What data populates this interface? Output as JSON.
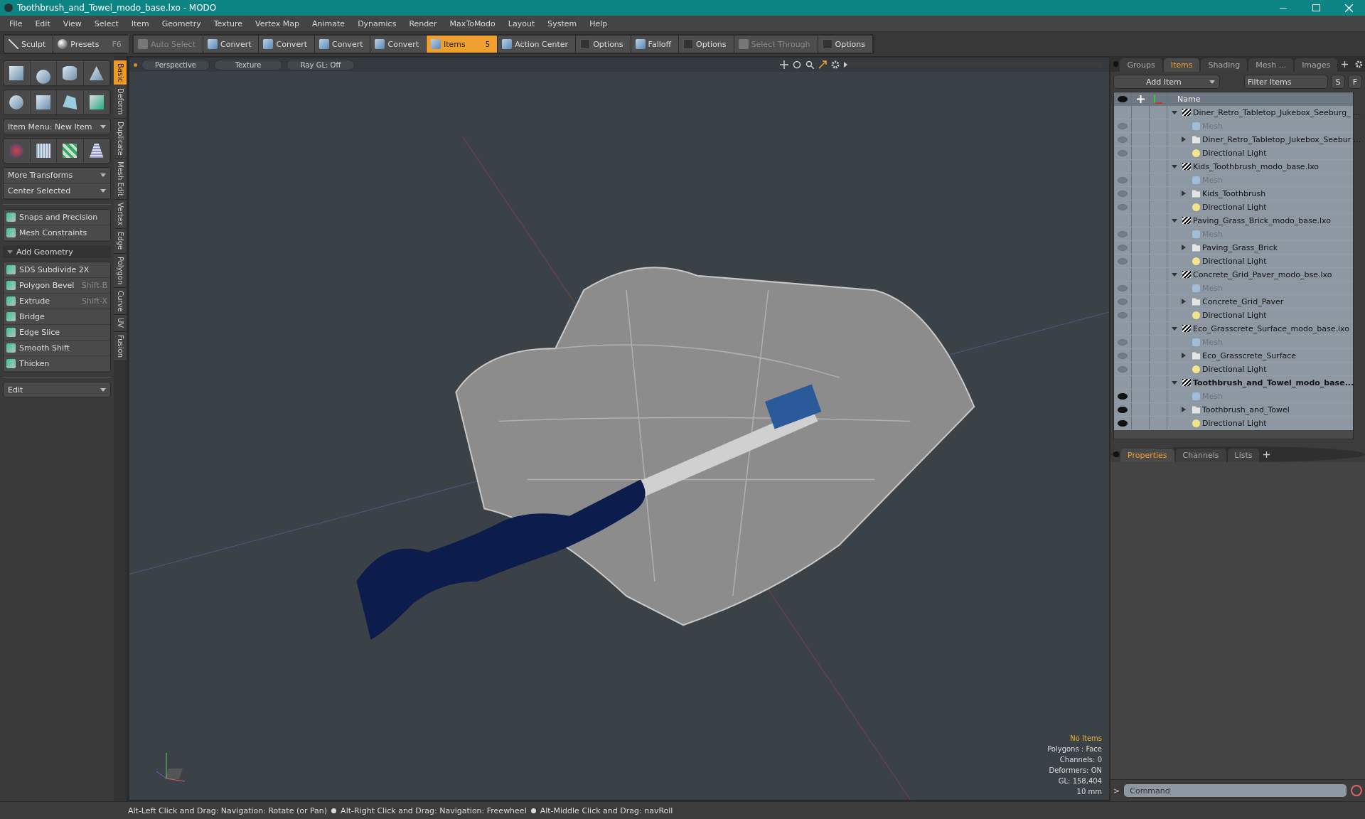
{
  "window": {
    "title": "Toothbrush_and_Towel_modo_base.lxo - MODO"
  },
  "menu": [
    "File",
    "Edit",
    "View",
    "Select",
    "Item",
    "Geometry",
    "Texture",
    "Vertex Map",
    "Animate",
    "Dynamics",
    "Render",
    "MaxToModo",
    "Layout",
    "System",
    "Help"
  ],
  "toolbar_left": [
    {
      "label": "Sculpt"
    },
    {
      "label": "Presets",
      "shortcut": "F6"
    }
  ],
  "toolbar": [
    {
      "label": "Auto Select",
      "kind": "button",
      "disabled": true,
      "selected": false
    },
    {
      "label": "Convert",
      "kind": "button",
      "disabled": false,
      "selected": false
    },
    {
      "label": "Convert",
      "kind": "button",
      "disabled": false,
      "selected": false
    },
    {
      "label": "Convert",
      "kind": "button",
      "disabled": false,
      "selected": false
    },
    {
      "label": "Convert",
      "kind": "button",
      "disabled": false,
      "selected": false
    },
    {
      "label": "Items",
      "kind": "button",
      "disabled": false,
      "selected": true,
      "badge": "5"
    },
    {
      "label": "Action Center",
      "kind": "button",
      "disabled": false,
      "selected": false
    },
    {
      "label": "Options",
      "kind": "check",
      "disabled": false,
      "selected": false
    },
    {
      "label": "Falloff",
      "kind": "button",
      "disabled": false,
      "selected": false
    },
    {
      "label": "Options",
      "kind": "check",
      "disabled": false,
      "selected": false
    },
    {
      "label": "Select Through",
      "kind": "button",
      "disabled": true,
      "selected": false
    },
    {
      "label": "Options",
      "kind": "check",
      "disabled": false,
      "selected": false
    }
  ],
  "left_panel": {
    "item_menu": "Item Menu: New Item",
    "transforms": [
      "More Transforms",
      "Center Selected"
    ],
    "snaps": [
      "Snaps and Precision",
      "Mesh Constraints"
    ],
    "section": "Add Geometry",
    "tools": [
      {
        "label": "SDS Subdivide 2X"
      },
      {
        "label": "Polygon Bevel",
        "shortcut": "Shift-B"
      },
      {
        "label": "Extrude",
        "shortcut": "Shift-X"
      },
      {
        "label": "Bridge"
      },
      {
        "label": "Edge Slice"
      },
      {
        "label": "Smooth Shift"
      },
      {
        "label": "Thicken"
      }
    ],
    "edit_menu": "Edit",
    "side_tabs": [
      {
        "label": "Basic",
        "selected": true
      },
      {
        "label": "Deform",
        "selected": false
      },
      {
        "label": "Duplicate",
        "selected": false
      },
      {
        "label": "Mesh Edit",
        "selected": false
      },
      {
        "label": "Vertex",
        "selected": false
      },
      {
        "label": "Edge",
        "selected": false
      },
      {
        "label": "Polygon",
        "selected": false
      },
      {
        "label": "Curve",
        "selected": false
      },
      {
        "label": "UV",
        "selected": false
      },
      {
        "label": "Fusion",
        "selected": false
      }
    ]
  },
  "viewport": {
    "buttons": [
      "Perspective",
      "Texture",
      "Ray GL: Off"
    ],
    "info": [
      {
        "text": "No Items",
        "highlight": true
      },
      {
        "text": "Polygons : Face",
        "highlight": false
      },
      {
        "text": "Channels: 0",
        "highlight": false
      },
      {
        "text": "Deformers: ON",
        "highlight": false
      },
      {
        "text": "GL: 158,404",
        "highlight": false
      },
      {
        "text": "10 mm",
        "highlight": false
      }
    ]
  },
  "items_panel": {
    "tabs": [
      {
        "label": "Groups",
        "selected": false
      },
      {
        "label": "Items",
        "selected": true
      },
      {
        "label": "Shading",
        "selected": false
      },
      {
        "label": "Mesh ...",
        "selected": false
      },
      {
        "label": "Images",
        "selected": false
      }
    ],
    "add_item": "Add Item",
    "filter_placeholder": "Filter Items",
    "filter_buttons": [
      "S",
      "F"
    ],
    "name_column": "Name",
    "tree": [
      {
        "label": "Diner_Retro_Tabletop_Jukebox_Seeburg_ ...",
        "active": false,
        "children": [
          {
            "label": "Mesh",
            "kind": "mesh"
          },
          {
            "label": "Diner_Retro_Tabletop_Jukebox_Seebur ...",
            "kind": "group"
          },
          {
            "label": "Directional Light",
            "kind": "light"
          }
        ]
      },
      {
        "label": "Kids_Toothbrush_modo_base.lxo",
        "active": false,
        "children": [
          {
            "label": "Mesh",
            "kind": "mesh"
          },
          {
            "label": "Kids_Toothbrush",
            "kind": "group"
          },
          {
            "label": "Directional Light",
            "kind": "light"
          }
        ]
      },
      {
        "label": "Paving_Grass_Brick_modo_base.lxo",
        "active": false,
        "children": [
          {
            "label": "Mesh",
            "kind": "mesh"
          },
          {
            "label": "Paving_Grass_Brick",
            "kind": "group"
          },
          {
            "label": "Directional Light",
            "kind": "light"
          }
        ]
      },
      {
        "label": "Concrete_Grid_Paver_modo_bse.lxo",
        "active": false,
        "children": [
          {
            "label": "Mesh",
            "kind": "mesh"
          },
          {
            "label": "Concrete_Grid_Paver",
            "kind": "group"
          },
          {
            "label": "Directional Light",
            "kind": "light"
          }
        ]
      },
      {
        "label": "Eco_Grasscrete_Surface_modo_base.lxo",
        "active": false,
        "children": [
          {
            "label": "Mesh",
            "kind": "mesh"
          },
          {
            "label": "Eco_Grasscrete_Surface",
            "kind": "group"
          },
          {
            "label": "Directional Light",
            "kind": "light"
          }
        ]
      },
      {
        "label": "Toothbrush_and_Towel_modo_base...",
        "active": true,
        "children": [
          {
            "label": "Mesh",
            "kind": "mesh"
          },
          {
            "label": "Toothbrush_and_Towel",
            "kind": "group"
          },
          {
            "label": "Directional Light",
            "kind": "light"
          }
        ]
      }
    ]
  },
  "properties_panel": {
    "tabs": [
      {
        "label": "Properties",
        "selected": true
      },
      {
        "label": "Channels",
        "selected": false
      },
      {
        "label": "Lists",
        "selected": false
      }
    ],
    "prompt": ">",
    "command_placeholder": "Command"
  },
  "status_bar": [
    "Alt-Left Click and Drag: Navigation: Rotate (or Pan)",
    "Alt-Right Click and Drag: Navigation: Freewheel",
    "Alt-Middle Click and Drag: navRoll"
  ]
}
